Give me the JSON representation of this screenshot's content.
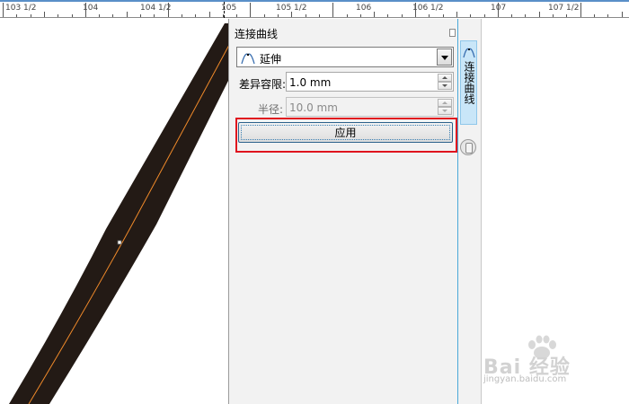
{
  "ruler": {
    "labels": [
      {
        "text": "103 1/2"
      },
      {
        "text": "104"
      },
      {
        "text": "104 1/2"
      },
      {
        "text": "105"
      },
      {
        "text": "105 1/2"
      },
      {
        "text": "106"
      },
      {
        "text": "106 1/2"
      },
      {
        "text": "107"
      },
      {
        "text": "107 1/2"
      }
    ]
  },
  "docker": {
    "title": "连接曲线",
    "mode_value": "延伸",
    "tolerance_label": "差异容限:",
    "tolerance_value": "1.0 mm",
    "radius_label": "半径:",
    "radius_value": "10.0 mm",
    "apply_label": "应用"
  },
  "sidetab": {
    "label": "连接曲线"
  },
  "watermark": {
    "brand": "Bai 经验",
    "url": "jingyan.baidu.com"
  },
  "colors": {
    "curve_fill": "#231a15",
    "curve_centerline": "#f08a2a",
    "highlight_box": "#e0141e",
    "tab_active": "#c9e6f8",
    "ruler_accent": "#5a8fc8"
  }
}
